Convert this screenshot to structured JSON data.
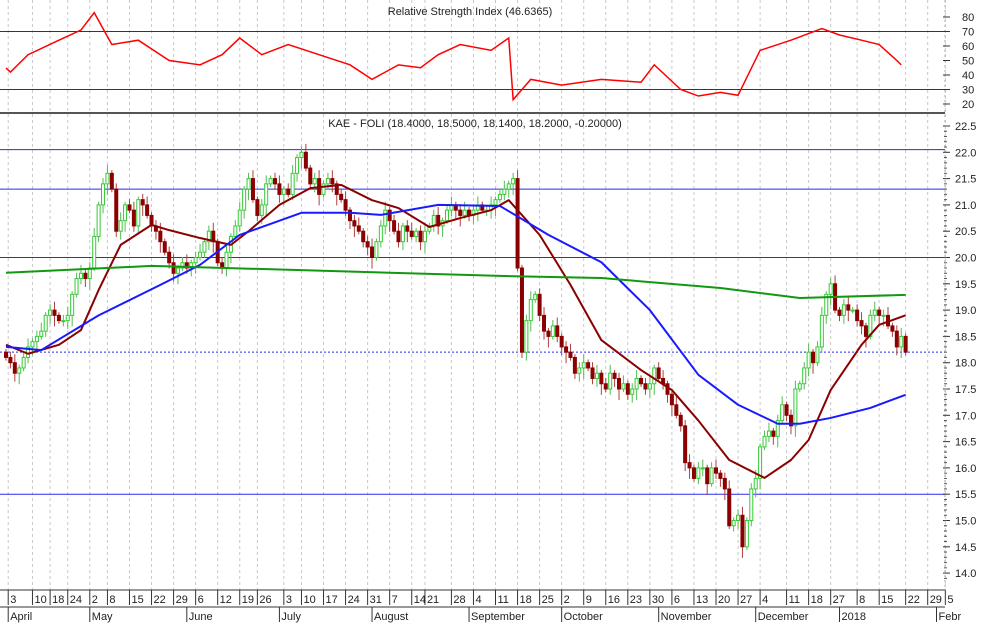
{
  "chart_data": {
    "type": "candlestick",
    "rsi_panel": {
      "title": "Relative Strength Index (46.6365)",
      "ylim": [
        15,
        85
      ],
      "ticks": [
        80,
        70,
        60,
        50,
        40,
        30,
        20
      ],
      "levels": [
        70,
        30
      ],
      "level_color": "#2020e0",
      "line_color": "#ff0000",
      "points": [
        [
          0,
          44.8
        ],
        [
          1,
          42
        ],
        [
          5,
          54
        ],
        [
          12,
          64
        ],
        [
          17,
          71
        ],
        [
          20,
          83
        ],
        [
          24,
          61
        ],
        [
          30,
          64
        ],
        [
          37,
          50
        ],
        [
          44,
          47
        ],
        [
          49,
          54
        ],
        [
          53,
          65.5
        ],
        [
          58,
          54
        ],
        [
          64,
          61
        ],
        [
          71,
          54
        ],
        [
          78,
          47
        ],
        [
          83,
          37
        ],
        [
          89,
          47
        ],
        [
          94,
          45
        ],
        [
          98,
          54
        ],
        [
          103,
          61
        ],
        [
          110,
          57
        ],
        [
          114,
          65.5
        ],
        [
          115,
          23
        ],
        [
          119,
          37
        ],
        [
          126,
          33
        ],
        [
          135,
          37
        ],
        [
          144,
          35
        ],
        [
          147,
          47
        ],
        [
          153,
          30
        ],
        [
          157,
          25.5
        ],
        [
          162,
          28
        ],
        [
          166,
          26
        ],
        [
          171,
          57
        ],
        [
          178,
          64
        ],
        [
          185,
          72
        ],
        [
          189,
          67.6
        ],
        [
          194,
          64
        ],
        [
          198,
          61
        ],
        [
          202,
          50
        ],
        [
          203,
          47
        ]
      ]
    },
    "price_panel": {
      "title": "KAE - FOLI (18.4000, 18.5000, 18.1400, 18.2000, -0.20000)",
      "ylim": [
        13.6,
        22.7
      ],
      "ticks": [
        "22.5",
        "22.0",
        "21.5",
        "21.0",
        "20.5",
        "20.0",
        "19.5",
        "19.0",
        "18.5",
        "18.0",
        "17.5",
        "17.0",
        "16.5",
        "16.0",
        "15.5",
        "15.0",
        "14.5",
        "14.0"
      ],
      "horizontal_lines": [
        22.05,
        21.3,
        20.0,
        15.5
      ],
      "last_close_line": 18.2,
      "up_color": "#33cc33",
      "down_color": "#8b0000",
      "close": [
        18.1,
        18.0,
        17.8,
        17.9,
        18.1,
        18.3,
        18.4,
        18.5,
        18.6,
        18.9,
        19.0,
        18.9,
        18.8,
        18.8,
        18.9,
        19.3,
        19.6,
        19.7,
        19.6,
        19.8,
        20.4,
        21.0,
        21.4,
        21.6,
        21.3,
        20.5,
        20.7,
        21.0,
        20.9,
        20.6,
        21.1,
        21.0,
        20.8,
        20.6,
        20.5,
        20.3,
        20.1,
        19.9,
        19.7,
        19.8,
        19.9,
        19.8,
        19.9,
        20.0,
        20.1,
        20.3,
        20.5,
        20.3,
        19.9,
        19.8,
        20.1,
        20.4,
        20.6,
        20.9,
        21.3,
        21.5,
        21.1,
        20.8,
        21.0,
        21.4,
        21.5,
        21.4,
        21.2,
        21.3,
        21.2,
        21.6,
        21.9,
        22.0,
        21.7,
        21.4,
        21.5,
        21.2,
        21.4,
        21.5,
        21.4,
        21.2,
        21.1,
        20.9,
        20.7,
        20.6,
        20.5,
        20.3,
        20.2,
        20.0,
        20.3,
        20.6,
        20.9,
        20.7,
        20.5,
        20.3,
        20.6,
        20.5,
        20.4,
        20.5,
        20.3,
        20.5,
        20.6,
        20.8,
        20.6,
        20.7,
        20.9,
        21.0,
        20.9,
        20.8,
        20.9,
        20.8,
        20.9,
        21.0,
        20.9,
        20.9,
        21.0,
        21.1,
        21.2,
        21.3,
        21.4,
        21.5,
        19.8,
        18.2,
        18.8,
        19.2,
        19.3,
        18.9,
        18.6,
        18.5,
        18.7,
        18.5,
        18.3,
        18.2,
        18.1,
        17.8,
        17.9,
        18.0,
        17.9,
        17.7,
        17.8,
        17.6,
        17.5,
        17.8,
        17.7,
        17.5,
        17.6,
        17.4,
        17.5,
        17.7,
        17.6,
        17.5,
        17.6,
        17.9,
        17.7,
        17.6,
        17.4,
        17.2,
        17.0,
        16.8,
        16.1,
        16.0,
        15.8,
        16.0,
        16.0,
        15.7,
        16.0,
        15.9,
        15.8,
        15.6,
        14.9,
        15.0,
        15.1,
        14.5,
        15.0,
        15.6,
        15.8,
        16.4,
        16.6,
        16.7,
        16.6,
        16.9,
        17.2,
        17.0,
        16.8,
        17.5,
        17.6,
        17.9,
        18.2,
        18.0,
        18.3,
        18.9,
        19.3,
        19.5,
        19.0,
        18.9,
        19.1,
        19.0,
        19.0,
        18.8,
        18.7,
        18.5,
        18.9,
        19.0,
        18.9,
        18.9,
        18.7,
        18.6,
        18.3,
        18.5,
        18.2
      ],
      "moving_averages": [
        {
          "name": "MA short",
          "color": "#8b0000",
          "points": [
            [
              0,
              18.34
            ],
            [
              5,
              18.17
            ],
            [
              12,
              18.34
            ],
            [
              17,
              18.62
            ],
            [
              21,
              19.38
            ],
            [
              26,
              20.24
            ],
            [
              33,
              20.62
            ],
            [
              37,
              20.52
            ],
            [
              44,
              20.37
            ],
            [
              51,
              20.24
            ],
            [
              55,
              20.5
            ],
            [
              62,
              21.0
            ],
            [
              69,
              21.32
            ],
            [
              76,
              21.38
            ],
            [
              83,
              21.09
            ],
            [
              89,
              20.94
            ],
            [
              96,
              20.58
            ],
            [
              103,
              20.75
            ],
            [
              110,
              20.9
            ],
            [
              114,
              21.09
            ],
            [
              121,
              20.43
            ],
            [
              128,
              19.48
            ],
            [
              135,
              18.43
            ],
            [
              144,
              17.86
            ],
            [
              151,
              17.48
            ],
            [
              157,
              16.9
            ],
            [
              164,
              16.15
            ],
            [
              172,
              15.81
            ],
            [
              178,
              16.15
            ],
            [
              182,
              16.53
            ],
            [
              187,
              17.48
            ],
            [
              194,
              18.34
            ],
            [
              198,
              18.72
            ],
            [
              204,
              18.9
            ]
          ]
        },
        {
          "name": "MA medium",
          "color": "#1a1aff",
          "points": [
            [
              0,
              18.3
            ],
            [
              8,
              18.24
            ],
            [
              21,
              18.9
            ],
            [
              35,
              19.48
            ],
            [
              44,
              19.86
            ],
            [
              53,
              20.43
            ],
            [
              67,
              20.85
            ],
            [
              78,
              20.85
            ],
            [
              85,
              20.81
            ],
            [
              98,
              21.0
            ],
            [
              112,
              20.98
            ],
            [
              123,
              20.43
            ],
            [
              135,
              19.91
            ],
            [
              146,
              19.0
            ],
            [
              157,
              17.77
            ],
            [
              166,
              17.2
            ],
            [
              175,
              16.84
            ],
            [
              180,
              16.84
            ],
            [
              187,
              16.95
            ],
            [
              196,
              17.14
            ],
            [
              204,
              17.39
            ]
          ]
        },
        {
          "name": "MA long",
          "color": "#119911",
          "points": [
            [
              0,
              19.71
            ],
            [
              33,
              19.84
            ],
            [
              67,
              19.76
            ],
            [
              112,
              19.65
            ],
            [
              135,
              19.61
            ],
            [
              162,
              19.42
            ],
            [
              180,
              19.23
            ],
            [
              204,
              19.29
            ]
          ]
        }
      ]
    },
    "x_axis": {
      "week_ticks": [
        [
          "3",
          0.5
        ],
        [
          "10",
          6
        ],
        [
          "18",
          10
        ],
        [
          "24",
          14
        ],
        [
          "2",
          19
        ],
        [
          "8",
          23
        ],
        [
          "15",
          28
        ],
        [
          "22",
          33
        ],
        [
          "29",
          38
        ],
        [
          "6",
          43
        ],
        [
          "12",
          48
        ],
        [
          "19",
          53
        ],
        [
          "26",
          57
        ],
        [
          "3",
          63
        ],
        [
          "10",
          67
        ],
        [
          "17",
          72
        ],
        [
          "24",
          77
        ],
        [
          "31",
          82
        ],
        [
          "7",
          87
        ],
        [
          "14",
          92
        ],
        [
          "21",
          95
        ],
        [
          "28",
          101
        ],
        [
          "4",
          106
        ],
        [
          "11",
          111
        ],
        [
          "18",
          116
        ],
        [
          "25",
          121
        ],
        [
          "2",
          126
        ],
        [
          "9",
          131
        ],
        [
          "16",
          136
        ],
        [
          "23",
          141
        ],
        [
          "30",
          146
        ],
        [
          "6",
          151
        ],
        [
          "13",
          156
        ],
        [
          "20",
          161
        ],
        [
          "27",
          166
        ],
        [
          "4",
          171
        ],
        [
          "11",
          177
        ],
        [
          "18",
          182
        ],
        [
          "27",
          187
        ],
        [
          "8",
          193
        ],
        [
          "15",
          198
        ],
        [
          "22",
          204
        ],
        [
          "29",
          209
        ],
        [
          "5",
          213
        ]
      ],
      "months": [
        [
          "April",
          0.5
        ],
        [
          "May",
          19
        ],
        [
          "June",
          41
        ],
        [
          "July",
          62
        ],
        [
          "August",
          83
        ],
        [
          "September",
          105
        ],
        [
          "October",
          126
        ],
        [
          "November",
          148
        ],
        [
          "December",
          170
        ],
        [
          "2018",
          189
        ],
        [
          "Febr",
          211
        ]
      ]
    }
  }
}
